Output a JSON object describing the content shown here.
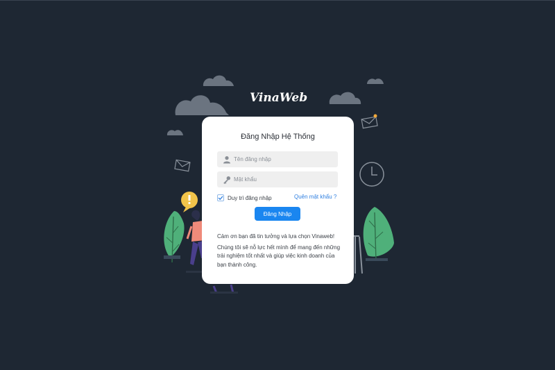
{
  "brand": {
    "logo_text": "VinaWeb"
  },
  "login": {
    "title": "Đăng Nhập Hệ Thống",
    "username_placeholder": "Tên đăng nhập",
    "password_placeholder": "Mật khẩu",
    "remember_label": "Duy trì đăng nhập",
    "remember_checked": true,
    "forgot_link": "Quên mật khẩu ?",
    "submit_label": "Đăng Nhập",
    "thanks_text": "Cảm ơn bạn đã tin tưởng và lựa chọn Vinaweb!",
    "description": "Chúng tôi sẽ nỗ lực hết mình để mang đến những trải nghiệm tốt nhất và giúp việc kinh doanh của bạn thành công."
  },
  "colors": {
    "background": "#1e2733",
    "card": "#ffffff",
    "primary": "#1a86f0",
    "link": "#2f7fe0",
    "input_bg": "#efefef",
    "plant": "#4fb07a",
    "bubble": "#f2c44a"
  },
  "icons": {
    "username": "user-icon",
    "password": "key-icon",
    "remember": "checkmark-icon"
  }
}
